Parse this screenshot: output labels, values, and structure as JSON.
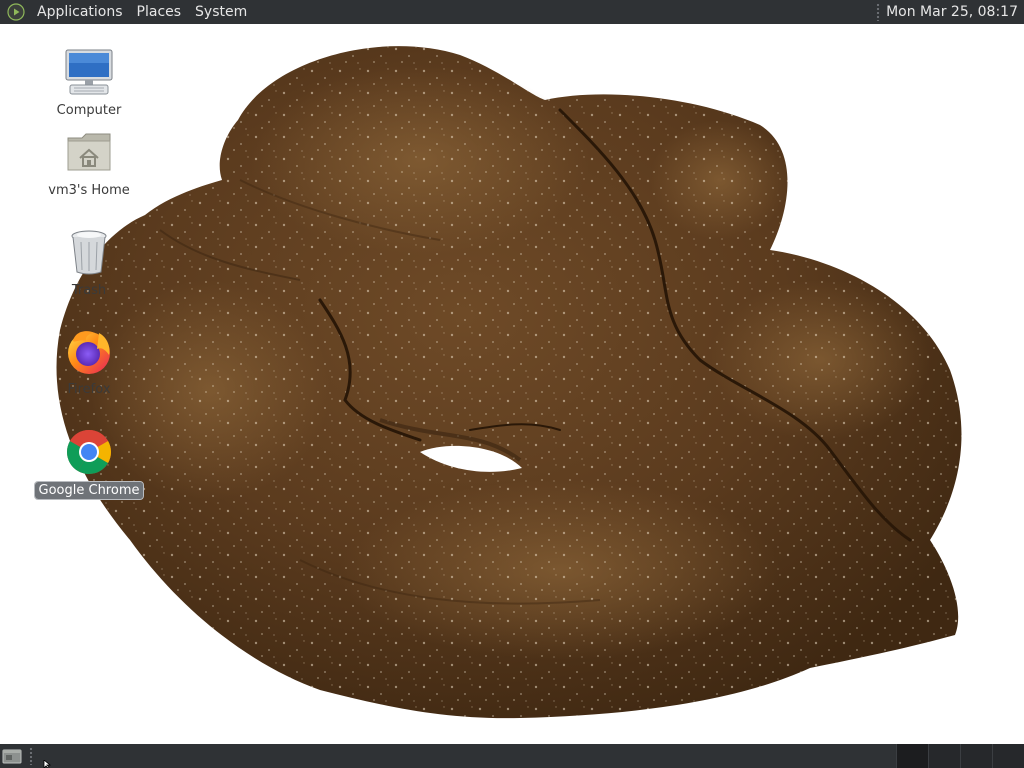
{
  "top_panel": {
    "menus": [
      "Applications",
      "Places",
      "System"
    ],
    "clock": "Mon Mar 25, 08:17",
    "logo_icon": "os-logo-icon"
  },
  "desktop": {
    "wallpaper": "brown-sculpture-image",
    "icons": [
      {
        "label": "Computer",
        "icon": "computer-icon",
        "selected": false
      },
      {
        "label": "vm3's Home",
        "icon": "home-folder-icon",
        "selected": false
      },
      {
        "label": "Trash",
        "icon": "trash-icon",
        "selected": false
      },
      {
        "label": "Firefox",
        "icon": "firefox-icon",
        "selected": false
      },
      {
        "label": "Google Chrome",
        "icon": "chrome-icon",
        "selected": true
      }
    ]
  },
  "bottom_panel": {
    "show_desktop_icon": "show-desktop-icon",
    "workspace_count": 4,
    "active_workspace": 1
  },
  "colors": {
    "panel": "#2f3235",
    "panel_text": "#e6e6e6",
    "selection": "#6f7378",
    "wallpaper_bg": "#ffffff",
    "sculpture": "#5a3a1e"
  }
}
